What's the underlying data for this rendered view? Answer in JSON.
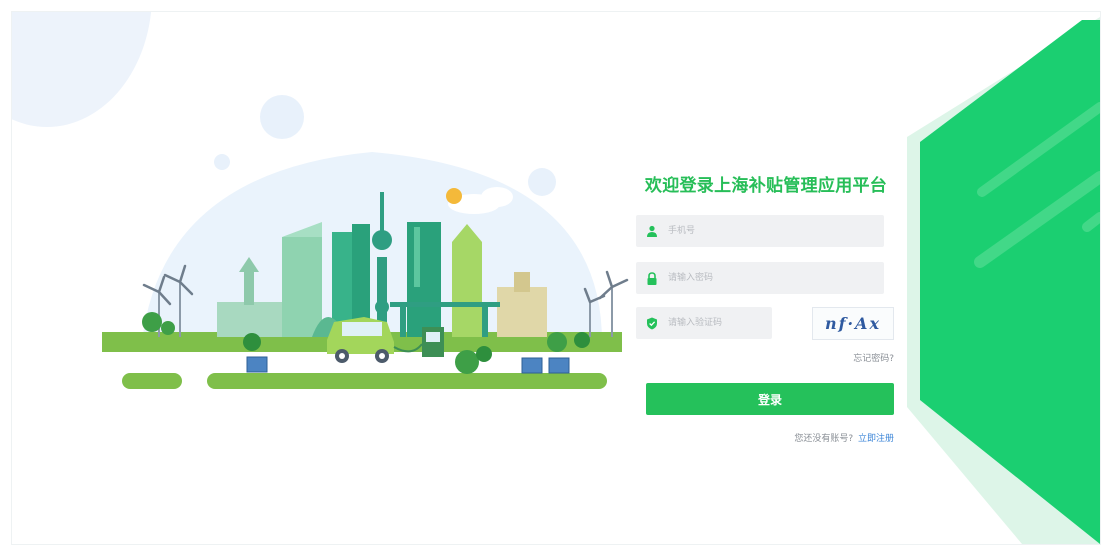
{
  "login": {
    "title": "欢迎登录上海补贴管理应用平台",
    "phone_placeholder": "手机号",
    "password_placeholder": "请输入密码",
    "code_placeholder": "请输入验证码",
    "captcha_text": "nf·Ax",
    "forgot_label": "忘记密码?",
    "login_button_label": "登录",
    "no_account_text": "您还没有账号?",
    "register_link_label": "立即注册"
  },
  "icons": {
    "phone_field_icon": "user-icon",
    "password_field_icon": "lock-icon",
    "code_field_icon": "shield-check-icon"
  },
  "colors": {
    "brand_green": "#25c15b",
    "panel_green": "#1bcf71",
    "link_blue": "#3c86d8",
    "input_bg": "#f0f1f3"
  }
}
